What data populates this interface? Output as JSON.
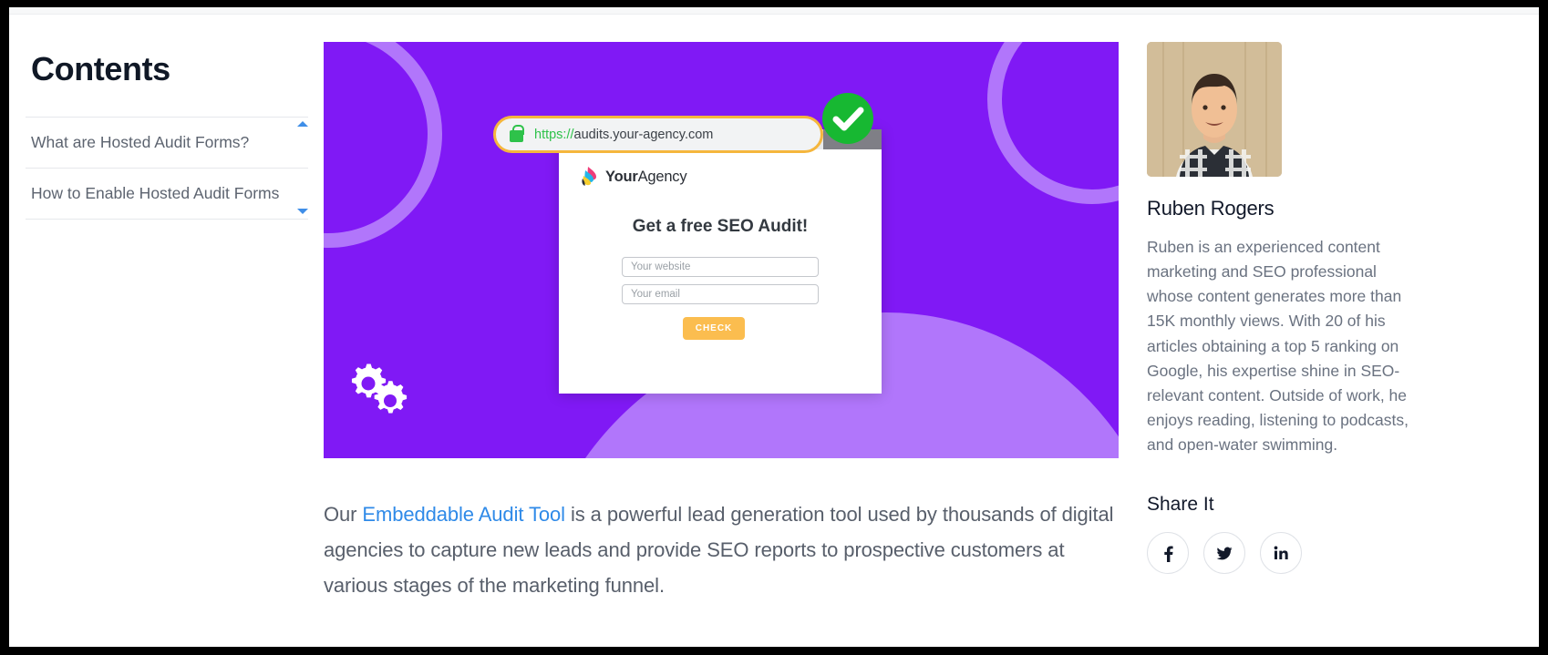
{
  "toc": {
    "title": "Contents",
    "items": [
      {
        "label": "What are Hosted Audit Forms?"
      },
      {
        "label": "How to Enable Hosted Audit Forms"
      }
    ]
  },
  "hero": {
    "background_color": "#8019F5",
    "accent_color": "#B176FB",
    "gear_icon": "gears-icon",
    "browser": {
      "lock_icon": "lock-icon",
      "url_scheme": "https://",
      "url_host": "audits.your-agency.com",
      "url_bar_border_color": "#F5B63D",
      "check_badge_icon": "check-circle-icon",
      "check_badge_color": "#17B832"
    },
    "mock_site": {
      "logo_icon": "youragency-logo-icon",
      "brand_bold": "Your",
      "brand_light": "Agency",
      "heading": "Get a free SEO Audit!",
      "website_placeholder": "Your website",
      "email_placeholder": "Your email",
      "submit_label": "CHECK",
      "submit_color": "#FBBD4F"
    }
  },
  "article": {
    "paragraph_lead": "Our ",
    "paragraph_link": "Embeddable Audit Tool",
    "paragraph_rest": " is a powerful lead generation tool used by thousands of digital agencies to capture new leads and provide SEO reports to prospective customers at various stages of the marketing funnel.",
    "link_color": "#2F8AE8"
  },
  "aside": {
    "author_photo_alt": "author-portrait",
    "author_name": "Ruben Rogers",
    "author_bio": "Ruben is an experienced content marketing and SEO professional whose content generates more than 15K monthly views. With 20 of his articles obtaining a top 5 ranking on Google, his expertise shine in SEO-relevant content. Outside of work, he enjoys reading, listening to podcasts, and open-water swimming.",
    "share_title": "Share It",
    "share_buttons": [
      {
        "name": "facebook-icon",
        "label": "Facebook"
      },
      {
        "name": "twitter-icon",
        "label": "Twitter"
      },
      {
        "name": "linkedin-icon",
        "label": "LinkedIn"
      }
    ]
  }
}
